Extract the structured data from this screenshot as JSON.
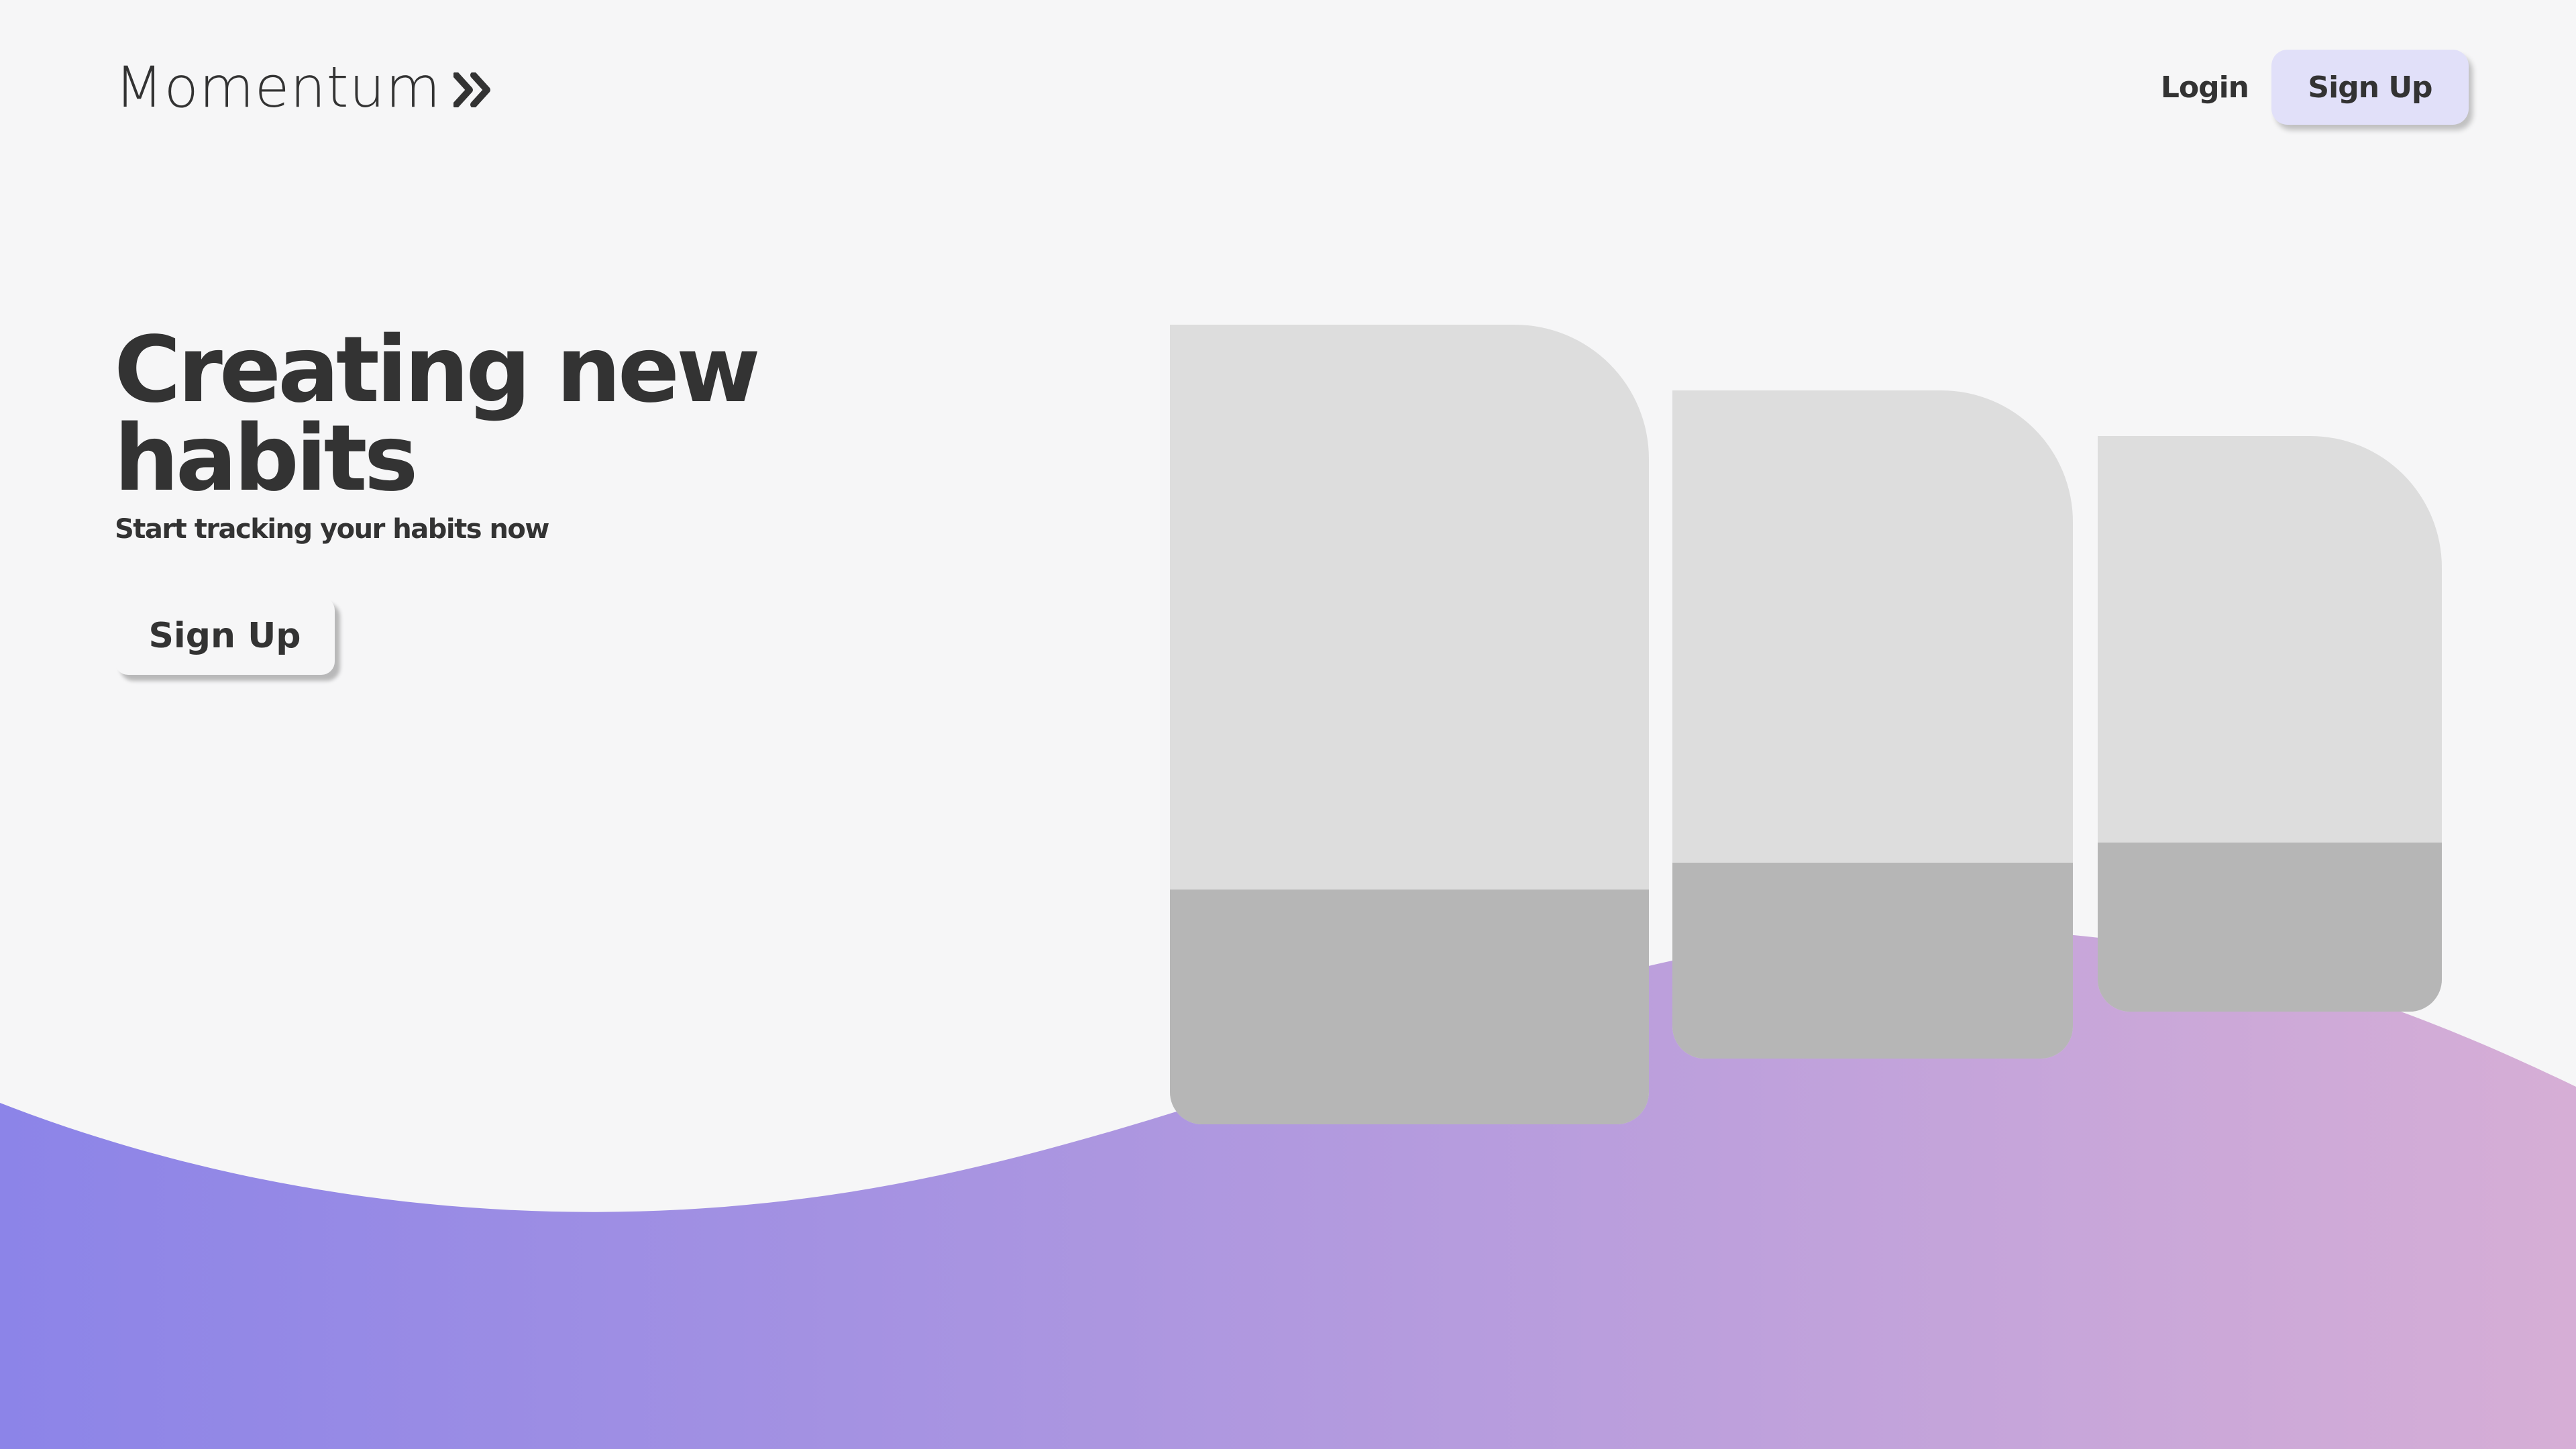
{
  "brand": {
    "name": "Momentum",
    "icon": "double-chevron-right-icon"
  },
  "nav": {
    "login_label": "Login",
    "signup_label": "Sign Up"
  },
  "hero": {
    "title": "Creating new habits",
    "subtitle": "Start tracking your habits now",
    "cta_label": "Sign Up"
  },
  "colors": {
    "background": "#f6f6f7",
    "text": "#333333",
    "nav_signup_bg": "#e1e0f9",
    "wave_start": "#8c84e8",
    "wave_end": "#d6aed6",
    "card_top": "#dddddd",
    "card_bottom": "#b6b6b6"
  }
}
